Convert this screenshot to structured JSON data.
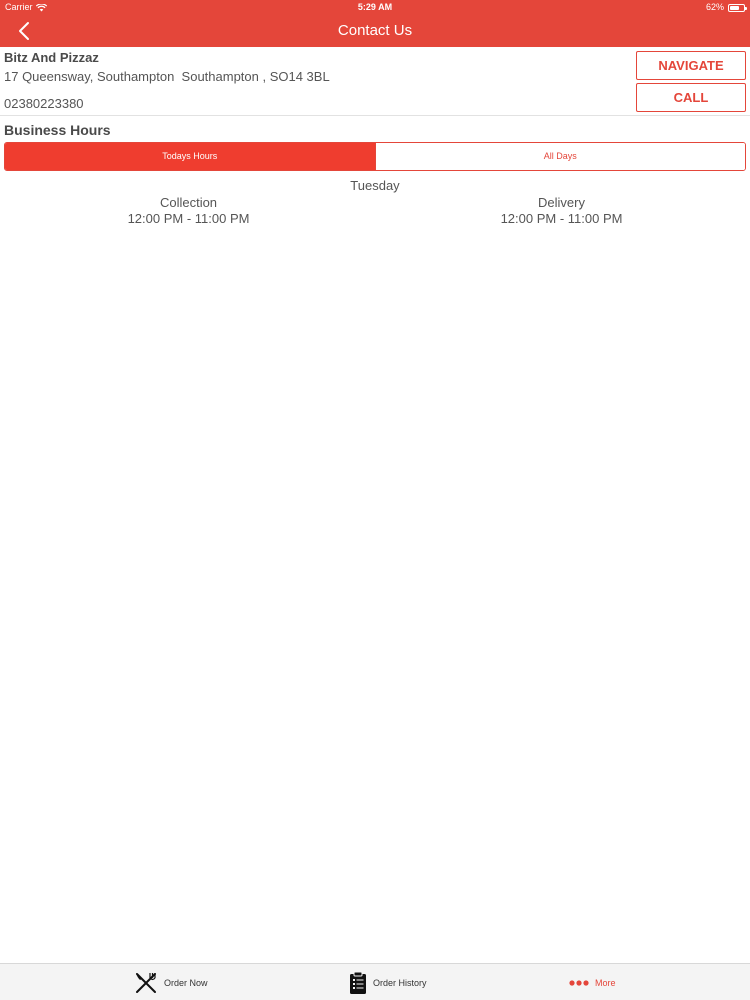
{
  "status_bar": {
    "carrier": "Carrier",
    "time": "5:29 AM",
    "battery": "62%"
  },
  "nav": {
    "title": "Contact Us",
    "back_icon": "chevron-left-icon"
  },
  "business": {
    "name": "Bitz And Pizzaz",
    "address": "17 Queensway, Southampton  Southampton , SO14 3BL",
    "phone": "02380223380"
  },
  "actions": {
    "navigate_label": "NAVIGATE",
    "call_label": "CALL"
  },
  "hours": {
    "section_title": "Business Hours",
    "tabs": [
      {
        "label": "Todays Hours",
        "active": true
      },
      {
        "label": "All Days",
        "active": false
      }
    ],
    "day": "Tuesday",
    "services": [
      {
        "type": "Collection",
        "time": "12:00 PM - 11:00 PM"
      },
      {
        "type": "Delivery",
        "time": "12:00 PM - 11:00 PM"
      }
    ]
  },
  "tabbar": {
    "items": [
      {
        "label": "Order Now",
        "icon": "fork-knife-icon"
      },
      {
        "label": "Order History",
        "icon": "clipboard-icon"
      },
      {
        "label": "More",
        "icon": "more-dots-icon"
      }
    ]
  },
  "colors": {
    "accent": "#e4463a",
    "segment_active": "#ef3d2f",
    "tabbar_bg": "#f4f4f4"
  }
}
